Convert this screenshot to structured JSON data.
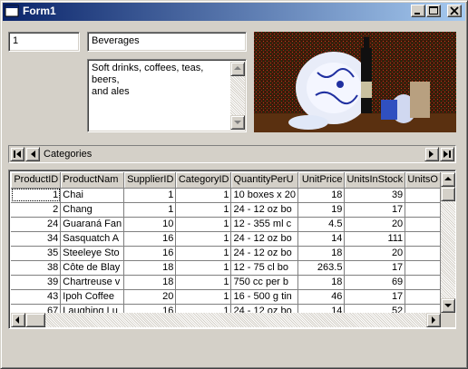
{
  "window": {
    "title": "Form1"
  },
  "category": {
    "id_value": "1",
    "name_value": "Beverages",
    "description_value": "Soft drinks, coffees, teas, beers,\nand ales",
    "picture": "beverages-still-life-image"
  },
  "data_control": {
    "caption": "Categories"
  },
  "grid": {
    "columns": [
      "ProductID",
      "ProductNam",
      "SupplierID",
      "CategoryID",
      "QuantityPerU",
      "UnitPrice",
      "UnitsInStock",
      "UnitsO"
    ],
    "rows": [
      [
        "1",
        "Chai",
        "1",
        "1",
        "10 boxes x 20",
        "18",
        "39",
        ""
      ],
      [
        "2",
        "Chang",
        "1",
        "1",
        "24 - 12 oz bo",
        "19",
        "17",
        ""
      ],
      [
        "24",
        "Guaraná Fan",
        "10",
        "1",
        "12 - 355 ml c",
        "4.5",
        "20",
        ""
      ],
      [
        "34",
        "Sasquatch A",
        "16",
        "1",
        "24 - 12 oz bo",
        "14",
        "111",
        ""
      ],
      [
        "35",
        "Steeleye Sto",
        "16",
        "1",
        "24 - 12 oz bo",
        "18",
        "20",
        ""
      ],
      [
        "38",
        "Côte de Blay",
        "18",
        "1",
        "12 - 75 cl bo",
        "263.5",
        "17",
        ""
      ],
      [
        "39",
        "Chartreuse v",
        "18",
        "1",
        "750 cc per b",
        "18",
        "69",
        ""
      ],
      [
        "43",
        "Ipoh Coffee",
        "20",
        "1",
        "16 - 500 g tin",
        "46",
        "17",
        ""
      ],
      [
        "67",
        "Laughing Lu",
        "16",
        "1",
        "24 - 12 oz bo",
        "14",
        "52",
        ""
      ]
    ]
  },
  "colors": {
    "title_start": "#0a246a",
    "title_end": "#a6caf0",
    "face": "#d4d0c8"
  }
}
